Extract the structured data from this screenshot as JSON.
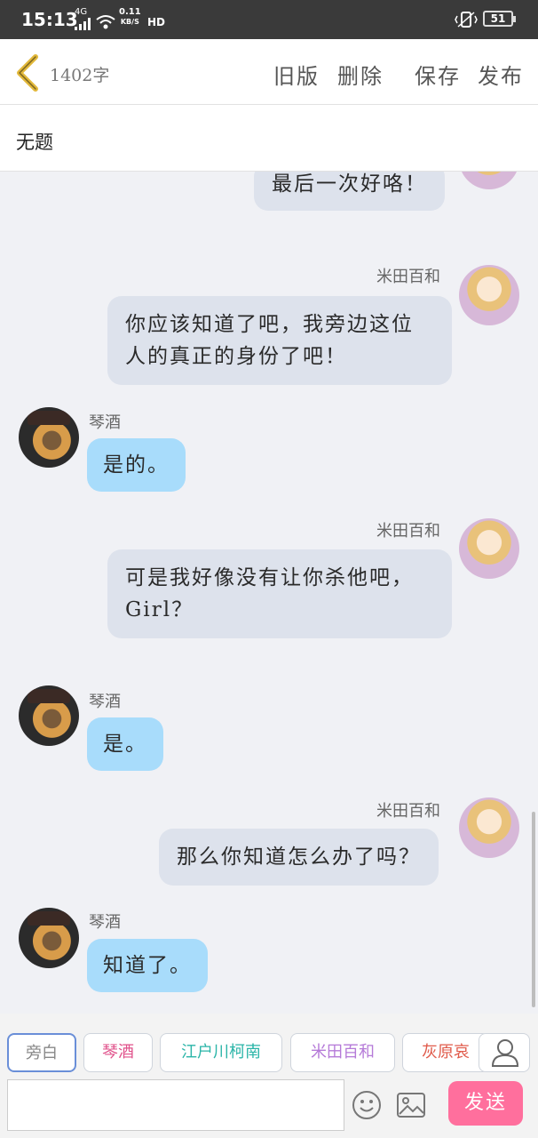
{
  "status_bar": {
    "time": "15:13",
    "network": "4G",
    "speed_value": "0.11",
    "speed_unit": "KB/S",
    "hd": "HD",
    "battery": "51"
  },
  "topbar": {
    "word_count": "1402字",
    "old_version": "旧版",
    "delete": "删除",
    "save": "保存",
    "publish": "发布"
  },
  "title": "无题",
  "messages": [
    {
      "side": "right",
      "text": "最后一次好咯！"
    },
    {
      "side": "right",
      "name": "米田百和",
      "text_lines": [
        "你应该知道了吧，我旁边这位",
        "人的真正的身份了吧！"
      ]
    },
    {
      "side": "left",
      "name": "琴酒",
      "text": "是的。"
    },
    {
      "side": "right",
      "name": "米田百和",
      "text_lines": [
        "可是我好像没有让你杀他吧，",
        "Girl？"
      ]
    },
    {
      "side": "left",
      "name": "琴酒",
      "text": "是。"
    },
    {
      "side": "right",
      "name": "米田百和",
      "text": "那么你知道怎么办了吗？"
    },
    {
      "side": "left",
      "name": "琴酒",
      "text": "知道了。"
    }
  ],
  "characters": [
    {
      "label": "旁白",
      "color": "#888888"
    },
    {
      "label": "琴酒",
      "color": "#e0508a"
    },
    {
      "label": "江户川柯南",
      "color": "#2bb5a8"
    },
    {
      "label": "米田百和",
      "color": "#b57ad8"
    },
    {
      "label": "灰原哀",
      "color": "#e05a4a"
    }
  ],
  "send_label": "发送"
}
